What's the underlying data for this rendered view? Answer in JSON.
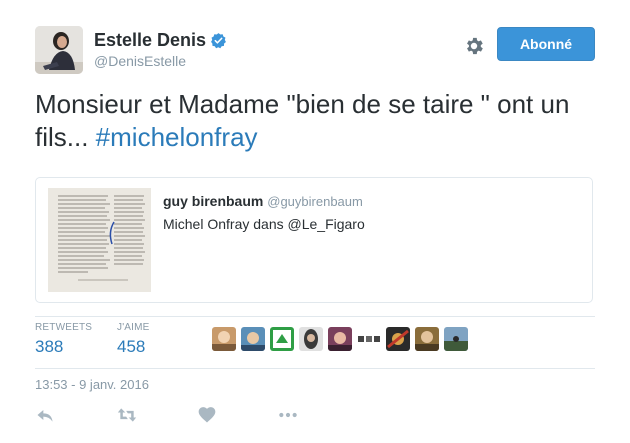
{
  "author": {
    "name": "Estelle Denis",
    "handle": "@DenisEstelle"
  },
  "follow_button": {
    "label": "Abonné"
  },
  "tweet": {
    "text_before": "Monsieur et Madame \"bien de se taire \" ont un fils... ",
    "hashtag": "#michelonfray"
  },
  "quoted_tweet": {
    "name": "guy birenbaum",
    "handle": "@guybirenbaum",
    "text": "Michel Onfray dans @Le_Figaro"
  },
  "stats": {
    "retweets_label": "RETWEETS",
    "retweets_value": "388",
    "likes_label": "J'AIME",
    "likes_value": "458"
  },
  "timestamp": "13:53 - 9 janv. 2016",
  "colors": {
    "accent": "#3b94d9",
    "link": "#2b7bb9",
    "muted": "#8899a6",
    "border": "#e1e8ed"
  },
  "icons": {
    "settings": "gear-icon",
    "verified": "verified-badge-icon",
    "reply": "reply-icon",
    "retweet": "retweet-icon",
    "like": "heart-icon",
    "more": "more-icon"
  }
}
